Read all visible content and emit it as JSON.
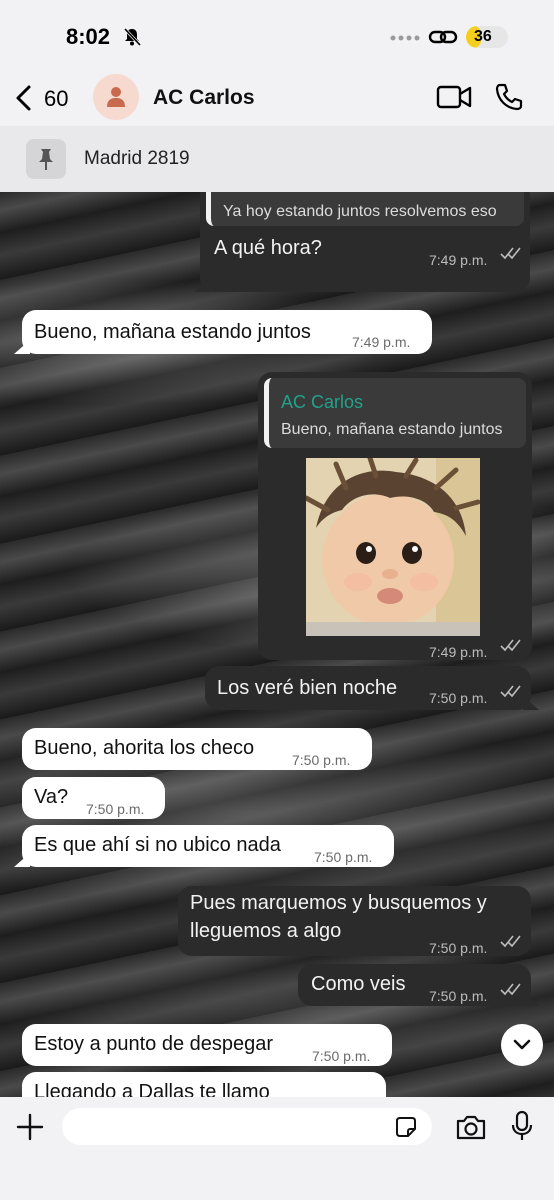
{
  "status_bar": {
    "time": "8:02",
    "battery": "36",
    "battery_level": 0.36
  },
  "header": {
    "back_count": "60",
    "contact_name": "AC Carlos"
  },
  "pinned": {
    "text": "Madrid 2819"
  },
  "messages": [
    {
      "direction": "out",
      "reply_name": "AC Carlos",
      "reply_text": "Ya hoy estando juntos resolvemos eso",
      "text": "A qué hora?",
      "time": "7:49 p.m."
    },
    {
      "direction": "in",
      "text": "Bueno, mañana estando juntos",
      "time": "7:49 p.m."
    },
    {
      "direction": "out",
      "reply_name": "AC Carlos",
      "reply_text": "Bueno, mañana estando juntos",
      "text": "",
      "time": "7:49 p.m.",
      "sticker": "baby-face-sticker"
    },
    {
      "direction": "out",
      "text": "Los veré bien noche",
      "time": "7:50 p.m."
    },
    {
      "direction": "in",
      "text": "Bueno, ahorita los checo",
      "time": "7:50 p.m."
    },
    {
      "direction": "in",
      "text": "Va?",
      "time": "7:50 p.m."
    },
    {
      "direction": "in",
      "text": "Es que ahí si no ubico nada",
      "time": "7:50 p.m."
    },
    {
      "direction": "out",
      "text": "Pues marquemos y busquemos y lleguemos a algo",
      "time": "7:50 p.m."
    },
    {
      "direction": "out",
      "text": "Como veis",
      "time": "7:50 p.m."
    },
    {
      "direction": "in",
      "text": "Estoy a punto de despegar",
      "time": "7:50 p.m."
    },
    {
      "direction": "in",
      "text": "Llegando a Dallas te llamo",
      "time": ""
    }
  ],
  "input": {
    "placeholder": ""
  },
  "icons": {
    "back": "chevron-left-icon",
    "video": "video-call-icon",
    "phone": "phone-icon",
    "pin": "pin-icon",
    "plus": "plus-icon",
    "sticker": "sticker-icon",
    "camera": "camera-icon",
    "mic": "microphone-icon",
    "scroll": "chevron-down-icon"
  },
  "colors": {
    "outgoing": "#2b2b2b",
    "incoming": "#ffffff",
    "reply_name": "#1fa38a",
    "battery": "#f5cf1d"
  }
}
